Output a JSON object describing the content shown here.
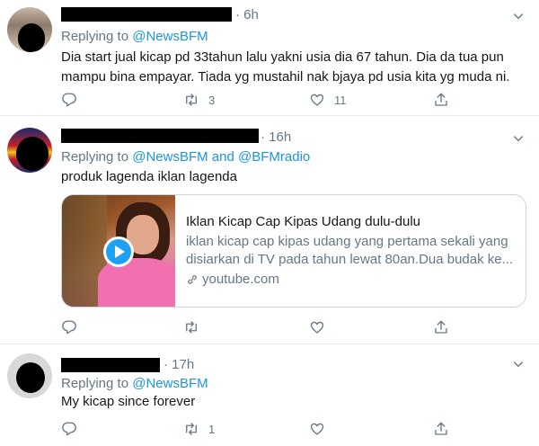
{
  "tweets": [
    {
      "time": "6h",
      "reply_prefix": "Replying to",
      "reply_to": "@NewsBFM",
      "reply_and": "",
      "reply_to_2": "",
      "text_line1": "Dia start jual kicap pd 33tahun lalu yakni usia dia 67 tahun. Dia da tua pun",
      "text_line2": "mampu bina empayar. Tiada yg mustahil nak bjaya pd usia kita yg muda ni.",
      "retweets": "3",
      "likes": "11"
    },
    {
      "time": "16h",
      "reply_prefix": "Replying to",
      "reply_to": "@NewsBFM",
      "reply_and": "and",
      "reply_to_2": "@BFMradio",
      "text_line1": "produk lagenda iklan lagenda",
      "card": {
        "title": "Iklan Kicap Cap Kipas Udang dulu-dulu",
        "description": "iklan kicap cap kipas udang yang pertama sekali yang disiarkan di TV pada tahun lewat 80an.Dua budak ke...",
        "domain": "youtube.com"
      },
      "retweets": "",
      "likes": ""
    },
    {
      "time": "17h",
      "reply_prefix": "Replying to",
      "reply_to": "@NewsBFM",
      "text_line1": "My kicap since forever",
      "retweets": "1",
      "likes": ""
    }
  ],
  "icons": {
    "reply": "reply-icon",
    "retweet": "retweet-icon",
    "like": "heart-icon",
    "share": "share-icon",
    "more": "chevron-down-icon",
    "link": "link-icon",
    "play": "play-icon"
  },
  "colors": {
    "link": "#1b95e0",
    "secondary": "#657786",
    "text": "#14171a",
    "divider": "#e6ecf0"
  }
}
